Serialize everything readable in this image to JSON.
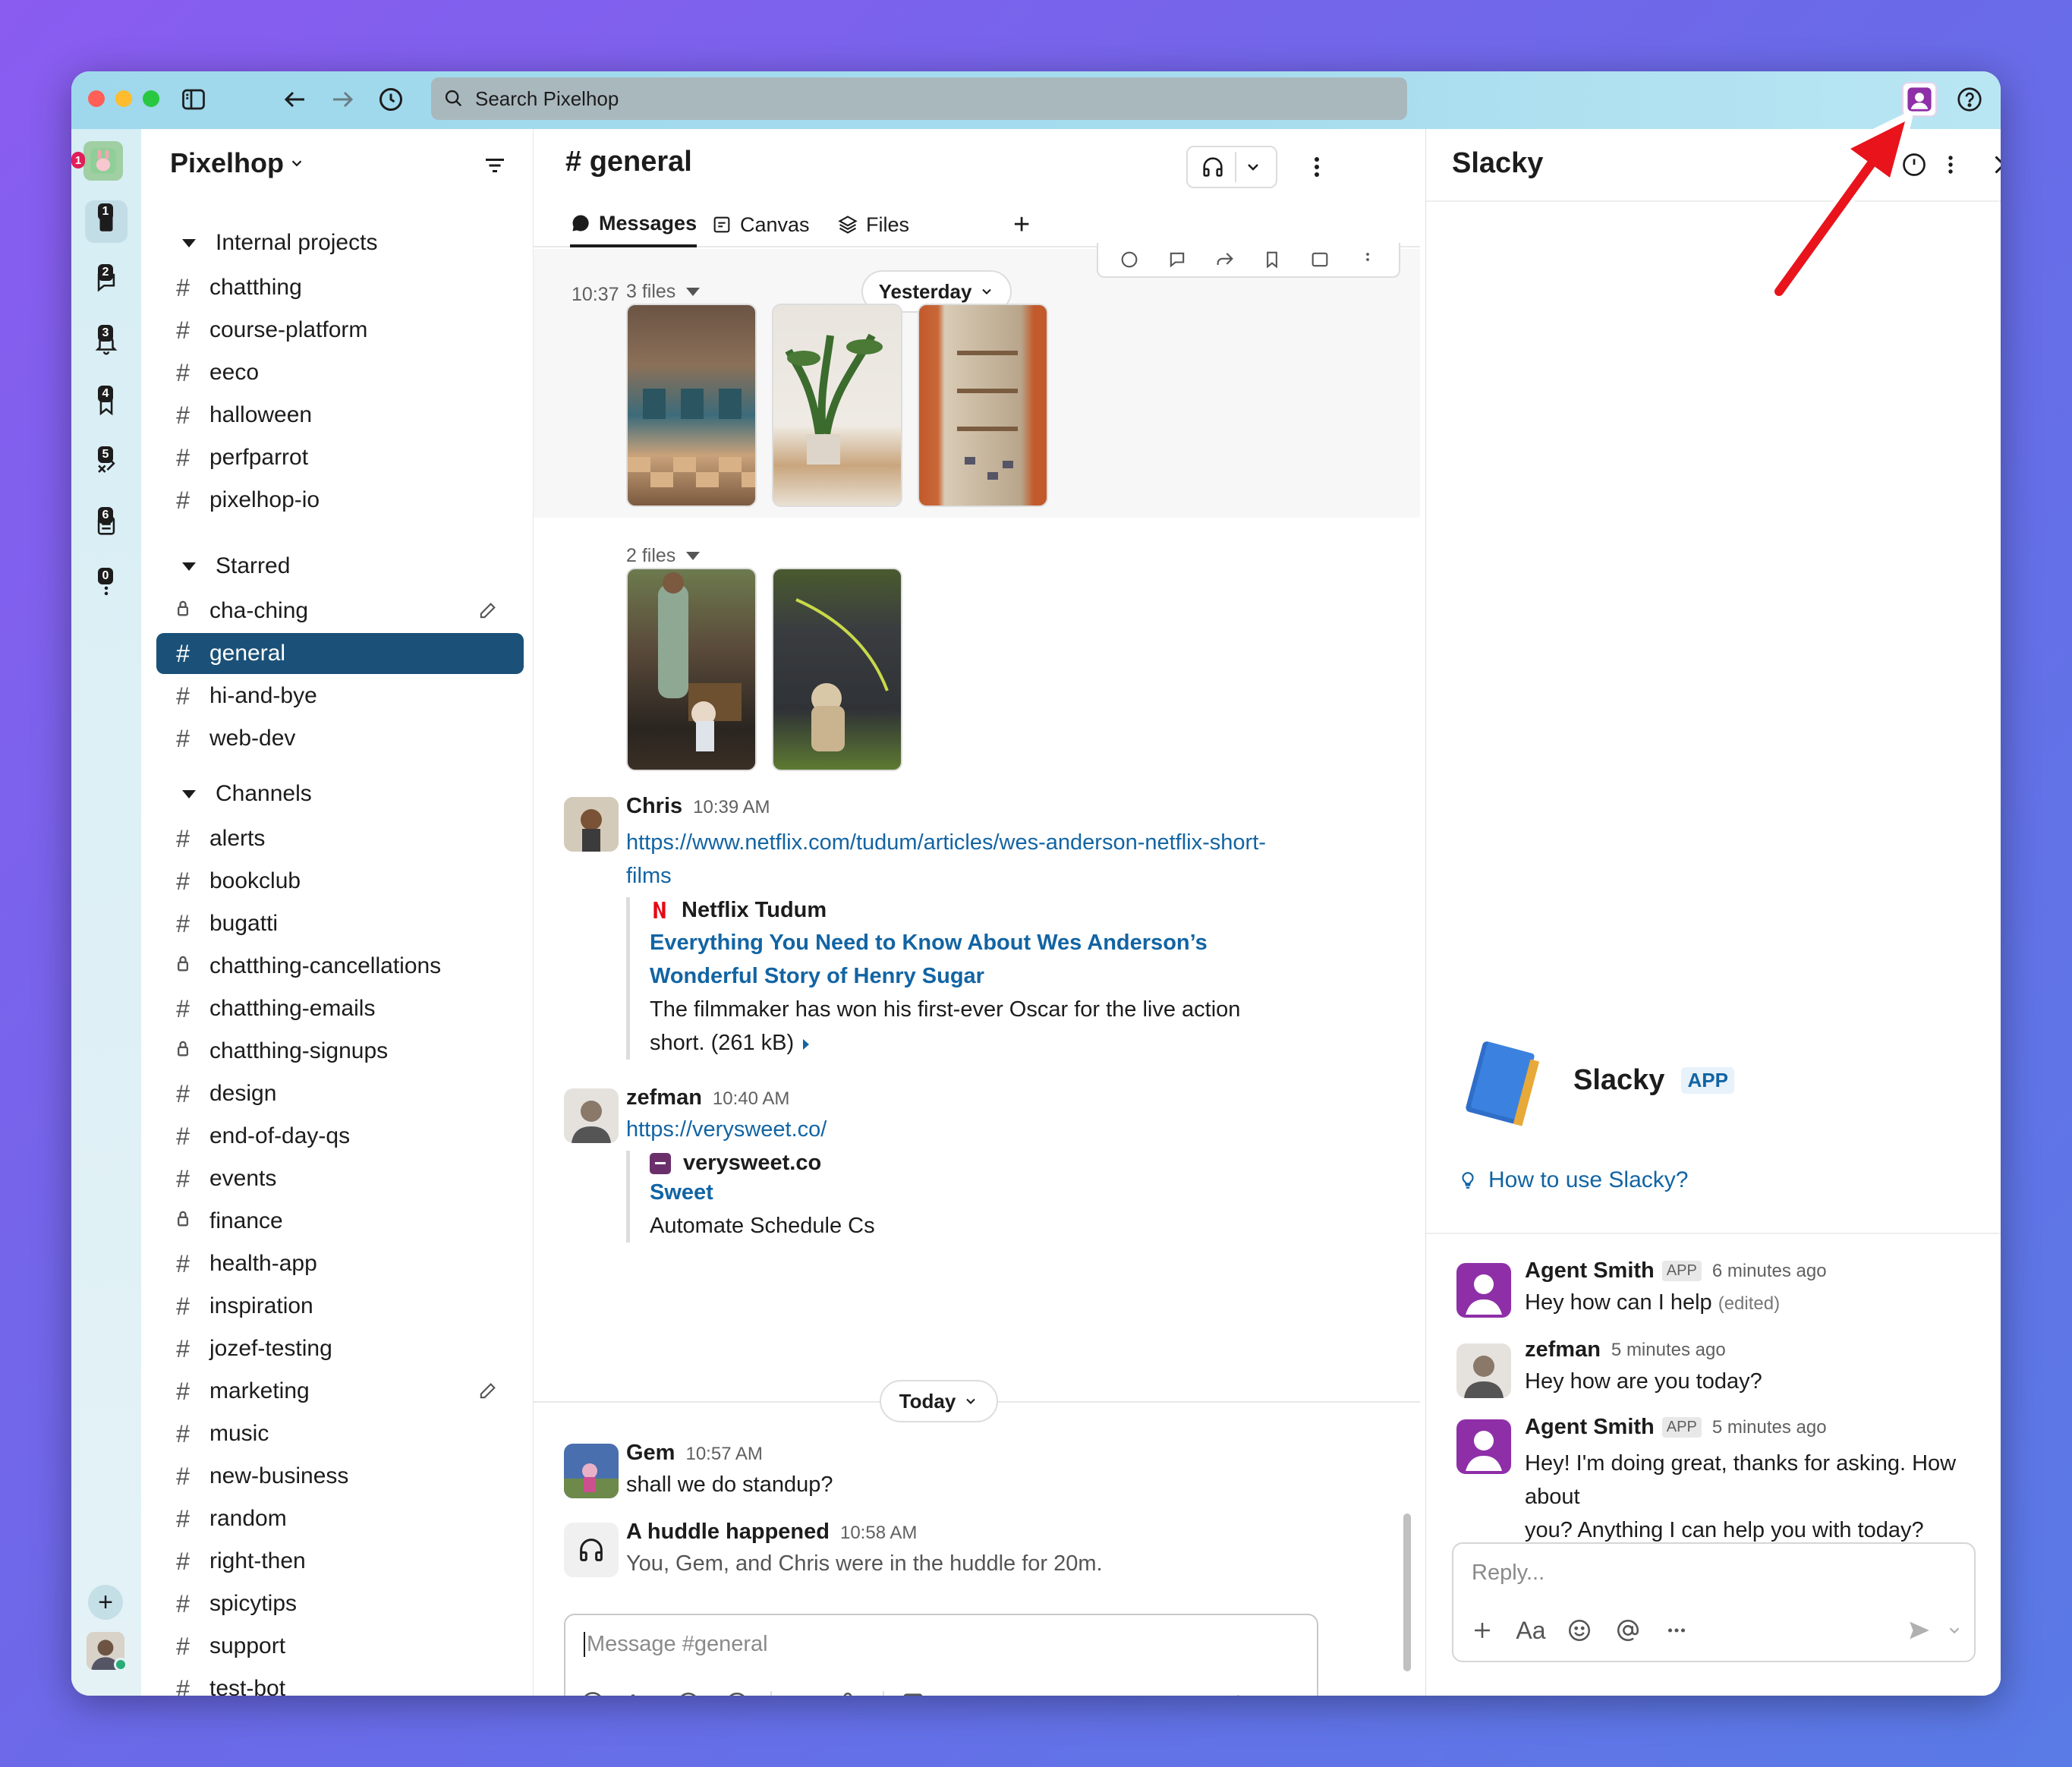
{
  "titlebar": {
    "search_placeholder": "Search Pixelhop"
  },
  "rail": {
    "badge": "1",
    "items": [
      {
        "num": "1",
        "icon": "home-icon"
      },
      {
        "num": "2",
        "icon": "messages-icon"
      },
      {
        "num": "3",
        "icon": "activity-icon"
      },
      {
        "num": "4",
        "icon": "bookmark-icon"
      },
      {
        "num": "5",
        "icon": "files-icon"
      },
      {
        "num": "6",
        "icon": "lists-icon"
      },
      {
        "num": "0",
        "icon": "more-icon"
      }
    ],
    "add": "+"
  },
  "sidebar": {
    "workspace": "Pixelhop",
    "sections": {
      "internal": "Internal projects",
      "starred": "Starred",
      "channels": "Channels"
    },
    "internal_channels": [
      "chatthing",
      "course-platform",
      "eeco",
      "halloween",
      "perfparrot",
      "pixelhop-io"
    ],
    "starred_channels": [
      "cha-ching",
      "general",
      "hi-and-bye",
      "web-dev"
    ],
    "channels": [
      "alerts",
      "bookclub",
      "bugatti",
      "chatthing-cancellations",
      "chatthing-emails",
      "chatthing-signups",
      "design",
      "end-of-day-qs",
      "events",
      "finance",
      "health-app",
      "inspiration",
      "jozef-testing",
      "marketing",
      "music",
      "new-business",
      "random",
      "right-then",
      "spicytips",
      "support",
      "test-bot"
    ]
  },
  "channel": {
    "title": "# general",
    "tabs": [
      "Messages",
      "Canvas",
      "Files"
    ],
    "add_tab": "+"
  },
  "feed": {
    "files1_time": "10:37",
    "files1_label": "3 files",
    "yesterday": "Yesterday",
    "files2_label": "2 files",
    "chris": {
      "name": "Chris",
      "time": "10:39 AM",
      "link_line1": "https://www.netflix.com/tudum/articles/wes-anderson-netflix-short-",
      "link_line2": "films",
      "site": "Netflix Tudum",
      "title_line1": "Everything You Need to Know About Wes Anderson’s",
      "title_line2": "Wonderful Story of Henry Sugar",
      "desc_line1": "The filmmaker has won his first-ever Oscar for the live action",
      "desc_line2": "short. (261 kB)"
    },
    "zefman": {
      "name": "zefman",
      "time": "10:40 AM",
      "link": "https://verysweet.co/",
      "site": "verysweet.co",
      "title": "Sweet",
      "desc": "Automate Schedule Cs"
    },
    "today": "Today",
    "gem": {
      "name": "Gem",
      "time": "10:57 AM",
      "text": "shall we do standup?"
    },
    "huddle": {
      "name": "A huddle happened",
      "time": "10:58 AM",
      "text": "You, Gem, and Chris were in the huddle for 20m."
    }
  },
  "composer": {
    "placeholder": "Message #general",
    "format": "Aa"
  },
  "panel": {
    "title": "Slacky",
    "app_name": "Slacky",
    "app_badge": "APP",
    "how_to": "How to use Slacky?",
    "messages": [
      {
        "name": "Agent Smith",
        "badge": "APP",
        "time": "6 minutes ago",
        "text": "Hey how can I help",
        "edited": "(edited)"
      },
      {
        "name": "zefman",
        "badge": "",
        "time": "5 minutes ago",
        "text": "Hey how are you today?"
      },
      {
        "name": "Agent Smith",
        "badge": "APP",
        "time": "5 minutes ago",
        "text_line1": "Hey! I'm doing great, thanks for asking. How about",
        "text_line2": "you? Anything I can help you with today?"
      }
    ],
    "reply_placeholder": "Reply...",
    "format": "Aa"
  },
  "colors": {
    "active_channel": "#1b5178",
    "link": "#1264a3",
    "arrow": "#e8131b",
    "slacky_avatar": "#8e2fa8"
  }
}
